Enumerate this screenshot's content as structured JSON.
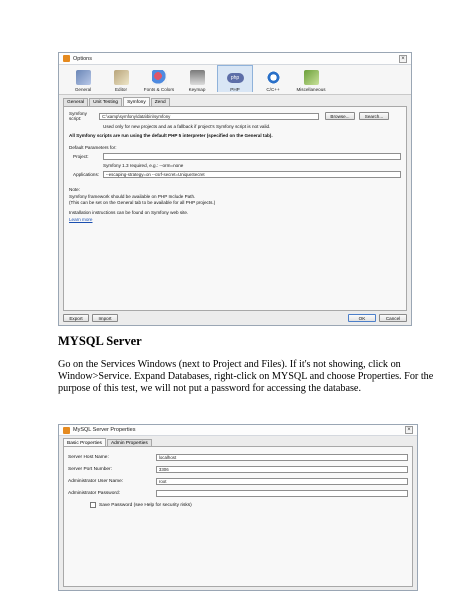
{
  "options_dialog": {
    "title": "Options",
    "categories": [
      "General",
      "Editor",
      "Fonts & Colors",
      "Keymap",
      "PHP",
      "C/C++",
      "Miscellaneous"
    ],
    "tabs": [
      "General",
      "Unit Testing",
      "Symfony",
      "Zend"
    ],
    "symfony_script_label": "Symfony script:",
    "symfony_script_value": "C:\\xamp\\symfony\\data\\bin\\symfony",
    "browse_label": "Browse...",
    "search_label": "Search...",
    "script_hint": "Used only for new projects and as a fallback if project's Symfony script is not valid.",
    "interpreter_note": "All Symfony scripts are run using the default PHP 5 interpreter (specified on the General tab).",
    "default_params_label": "Default Parameters for:",
    "project_label": "Project:",
    "project_value": "",
    "symfony_req": "Symfony 1.3 required, e.g.: --orm=none",
    "applications_label": "Applications:",
    "applications_value": "--escaping-strategy=on --csrf-secret=UniqueSecret",
    "note_label": "Note:",
    "note_line1": "Symfony framework should be available on PHP Include Path.",
    "note_line2": "(This can be set on the General tab to be available for all PHP projects.)",
    "install_text": "Installation instructions can be found on Symfony web site.",
    "learn_more": "Learn more",
    "export_label": "Export",
    "import_label": "Import",
    "ok_label": "OK",
    "cancel_label": "Cancel"
  },
  "heading": "MYSQL Server",
  "paragraph": "Go on the Services Windows (next to Project and Files). If it's not showing, click on Window>Service. Expand Databases, right-click on MYSQL and choose Properties. For the purpose of this test, we will not put a password for accessing the database.",
  "mysql_dialog": {
    "title": "MySQL Server Properties",
    "tabs": [
      "Basic Properties",
      "Admin Properties"
    ],
    "host_label": "Server Host Name:",
    "host_value": "localhost",
    "port_label": "Server Port Number:",
    "port_value": "3306",
    "user_label": "Administrator User Name:",
    "user_value": "root",
    "password_label": "Administrator Password:",
    "password_value": "",
    "save_password_label": "Save Password (see Help for security risks)"
  }
}
